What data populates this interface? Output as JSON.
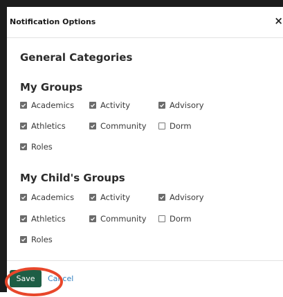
{
  "dialog": {
    "title": "Notification Options",
    "close_glyph": "×",
    "general_heading": "General Categories"
  },
  "my_groups": {
    "heading": "My Groups",
    "options": [
      {
        "label": "Academics",
        "checked": true
      },
      {
        "label": "Activity",
        "checked": true
      },
      {
        "label": "Advisory",
        "checked": true
      },
      {
        "label": "Athletics",
        "checked": true
      },
      {
        "label": "Community",
        "checked": true
      },
      {
        "label": "Dorm",
        "checked": false
      },
      {
        "label": "Roles",
        "checked": true
      }
    ]
  },
  "child_groups": {
    "heading": "My Child's Groups",
    "options": [
      {
        "label": "Academics",
        "checked": true
      },
      {
        "label": "Activity",
        "checked": true
      },
      {
        "label": "Advisory",
        "checked": true
      },
      {
        "label": "Athletics",
        "checked": true
      },
      {
        "label": "Community",
        "checked": true
      },
      {
        "label": "Dorm",
        "checked": false
      },
      {
        "label": "Roles",
        "checked": true
      }
    ]
  },
  "footer": {
    "save_label": "Save",
    "cancel_label": "Cancel"
  },
  "colors": {
    "save_button": "#1e5e45",
    "cancel_link": "#2f7fc0",
    "annotation": "#e8472b"
  }
}
